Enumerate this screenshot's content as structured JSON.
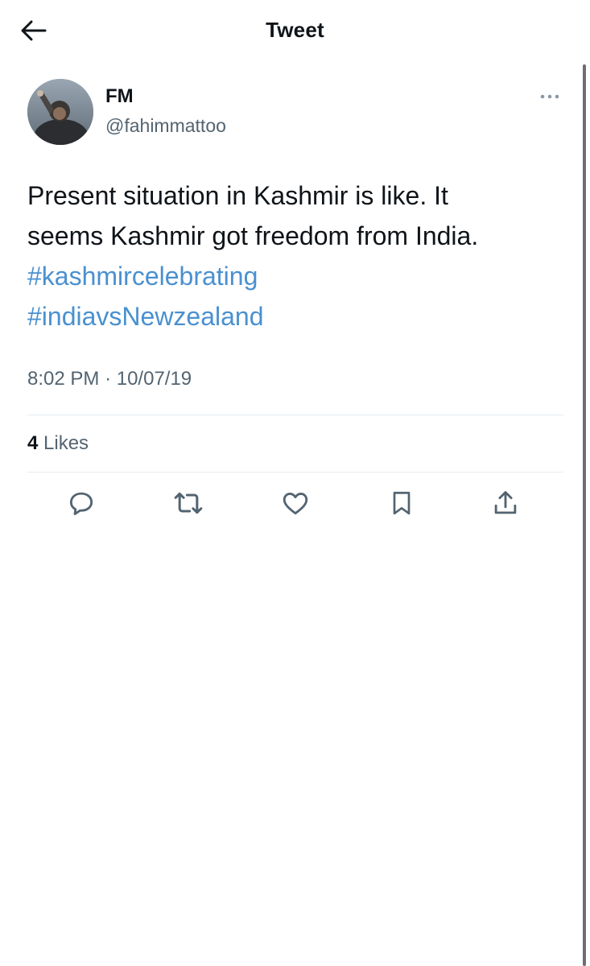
{
  "header": {
    "title": "Tweet",
    "back_icon": "arrow-left-icon"
  },
  "author": {
    "name": "FM",
    "handle": "@fahimmattoo",
    "avatar_icon": "profile-photo"
  },
  "tweet": {
    "text_line_1": "Present situation in Kashmir is like. It",
    "text_line_2": "seems Kashmir got freedom from India.",
    "hashtag_1": "#kashmircelebrating",
    "hashtag_2": "#indiavsNewzealand",
    "time": "8:02 PM",
    "separator": "·",
    "date": "10/07/19"
  },
  "stats": {
    "likes_count": "4",
    "likes_label": "Likes"
  },
  "actions": [
    {
      "icon": "reply-icon"
    },
    {
      "icon": "retweet-icon"
    },
    {
      "icon": "like-icon"
    },
    {
      "icon": "bookmark-icon"
    },
    {
      "icon": "share-icon"
    }
  ],
  "colors": {
    "text": "#0f1419",
    "secondary": "#536471",
    "hashtag": "#4a90d0",
    "divider": "#e6ecf0"
  }
}
